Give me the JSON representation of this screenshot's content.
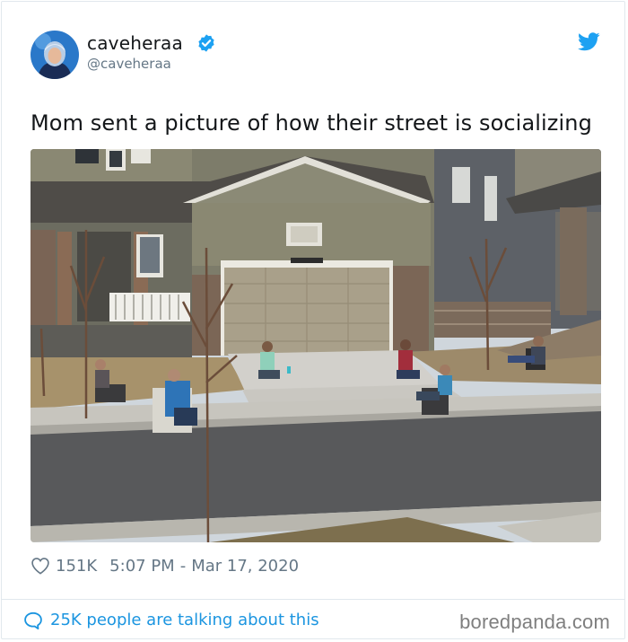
{
  "tweet": {
    "display_name": "caveheraa",
    "handle": "@caveheraa",
    "text": "Mom sent a picture of how their street is socializing",
    "likes": "151K",
    "time": "5:07 PM",
    "separator": "-",
    "date": "Mar 17, 2020",
    "talking": "25K people are talking about this"
  },
  "icons": {
    "verified": "verified-badge-icon",
    "bird": "twitter-bird-icon",
    "heart": "heart-outline-icon",
    "bubble": "comment-bubble-icon"
  },
  "colors": {
    "accent": "#1b95e0",
    "muted": "#657786",
    "text": "#14171a",
    "verified": "#1da1f2"
  },
  "watermark": "boredpanda.com"
}
